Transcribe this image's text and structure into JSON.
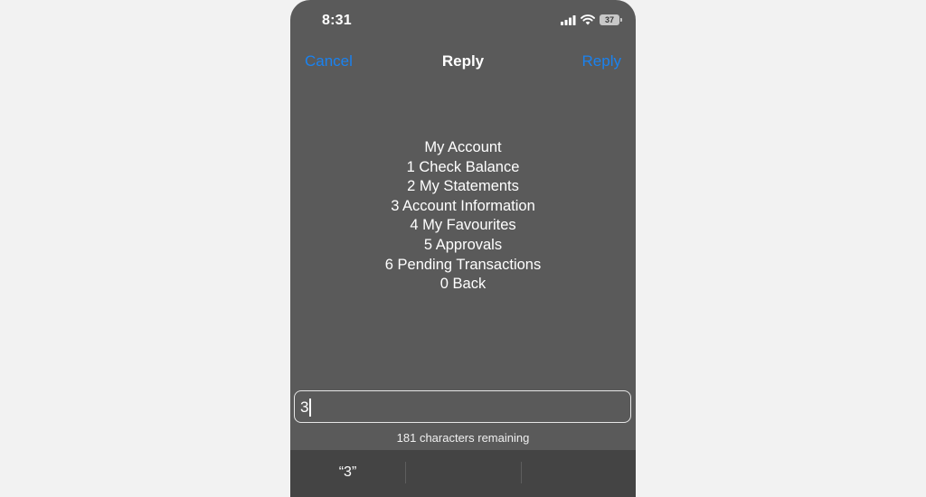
{
  "status_bar": {
    "time": "8:31",
    "battery": "37"
  },
  "nav": {
    "cancel_label": "Cancel",
    "title": "Reply",
    "reply_label": "Reply",
    "accent_color": "#1a82f0"
  },
  "message": {
    "lines": [
      "My Account",
      "1 Check Balance",
      "2 My Statements",
      "3 Account Information",
      "4 My Favourites",
      "5 Approvals",
      "6 Pending Transactions",
      "0 Back"
    ]
  },
  "reply_input": {
    "value": "3"
  },
  "char_count": "181 characters remaining",
  "suggestions": [
    "“3”",
    "",
    ""
  ]
}
